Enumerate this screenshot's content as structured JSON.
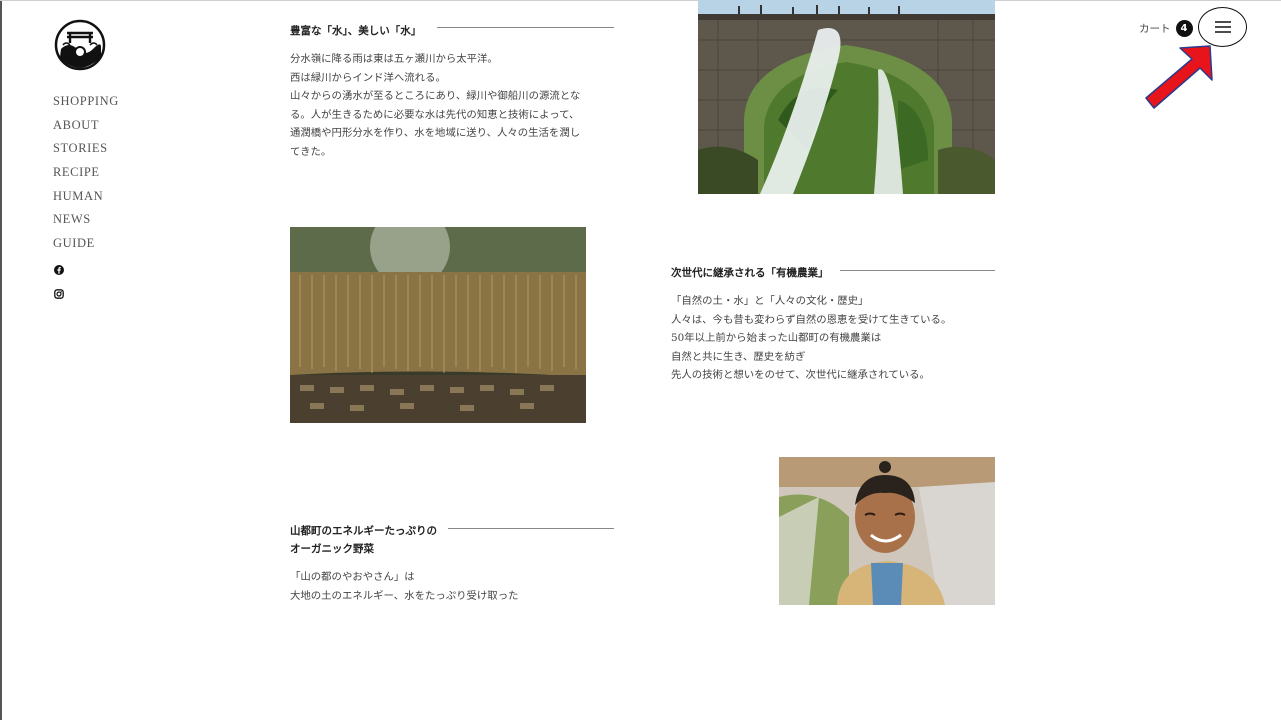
{
  "nav": {
    "items": [
      "SHOPPING",
      "ABOUT",
      "STORIES",
      "RECIPE",
      "HUMAN",
      "NEWS",
      "GUIDE"
    ]
  },
  "social": {
    "facebook": "facebook-icon",
    "instagram": "instagram-icon"
  },
  "header": {
    "cart_label": "カート",
    "cart_count": "4",
    "menu_icon": "hamburger-menu-icon"
  },
  "annotation": {
    "arrow_color": "#e8141c",
    "arrow_outline": "#2a3a8c"
  },
  "sections": {
    "water": {
      "title": "豊富な「水」、美しい「水」",
      "lines": [
        "分水嶺に降る雨は東は五ヶ瀬川から太平洋。",
        "西は緑川からインド洋へ流れる。",
        "山々からの湧水が至るところにあり、緑川や御船川の源流とな",
        "る。人が生きるために必要な水は先代の知恵と技術によって、",
        "通潤橋や円形分水を作り、水を地域に送り、人々の生活を潤し",
        "てきた。"
      ]
    },
    "organic": {
      "title": "次世代に継承される「有機農業」",
      "lines": [
        "「自然の土・水」と「人々の文化・歴史」",
        "人々は、今も昔も変わらず自然の恩恵を受けて生きている。",
        "50年以上前から始まった山都町の有機農業は",
        "自然と共に生き、歴史を紡ぎ",
        "先人の技術と想いをのせて、次世代に継承されている。"
      ]
    },
    "vegetables": {
      "title_line1": "山都町のエネルギーたっぷりの",
      "title_line2": "オーガニック野菜",
      "lines": [
        "「山の都のやおやさん」は",
        "大地の土のエネルギー、水をたっぷり受け取った"
      ]
    }
  }
}
